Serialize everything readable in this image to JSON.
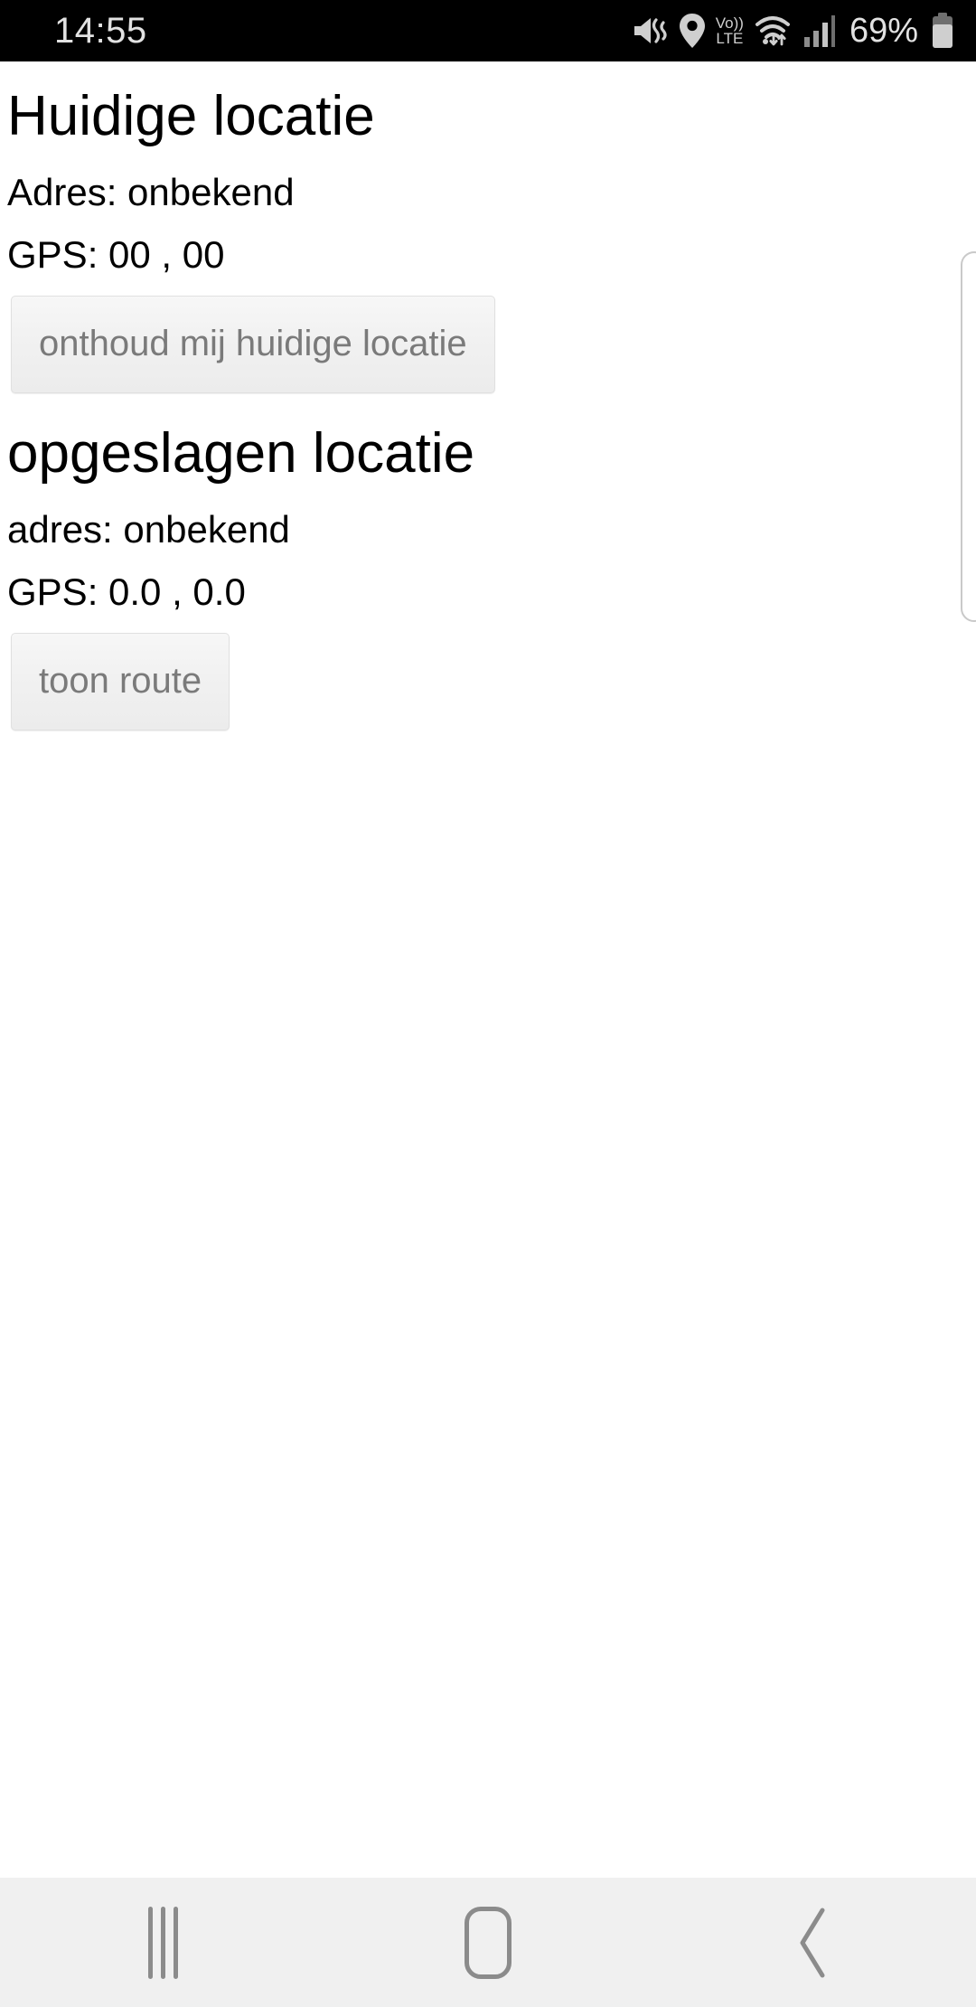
{
  "statusbar": {
    "time": "14:55",
    "battery_percent": "69%",
    "volte_top": "Vo))",
    "volte_bottom": "LTE",
    "icons": [
      "mute-vibrate-icon",
      "location-pin-icon",
      "volte-icon",
      "wifi-icon",
      "signal-bars-icon",
      "battery-icon"
    ]
  },
  "current_location": {
    "heading": "Huidige locatie",
    "address_line": "Adres: onbekend",
    "gps_line": "GPS: 00 , 00",
    "save_button": "onthoud mij huidige locatie"
  },
  "saved_location": {
    "heading": "opgeslagen locatie",
    "address_line": "adres: onbekend",
    "gps_line": "GPS: 0.0 , 0.0",
    "route_button": "toon route"
  },
  "navbar": {
    "recents_label": "recents-button",
    "home_label": "home-button",
    "back_label": "back-button"
  },
  "colors": {
    "statusbar_bg": "#000000",
    "statusbar_fg": "#e2e2e2",
    "page_bg": "#ffffff",
    "text": "#000000",
    "button_text": "#7a7a7a",
    "button_bg": "#f1f1f1",
    "navbar_bg": "#f0f0f0",
    "navbar_icon": "#8b8b8b",
    "scrollbar": "#c9c9c9"
  }
}
